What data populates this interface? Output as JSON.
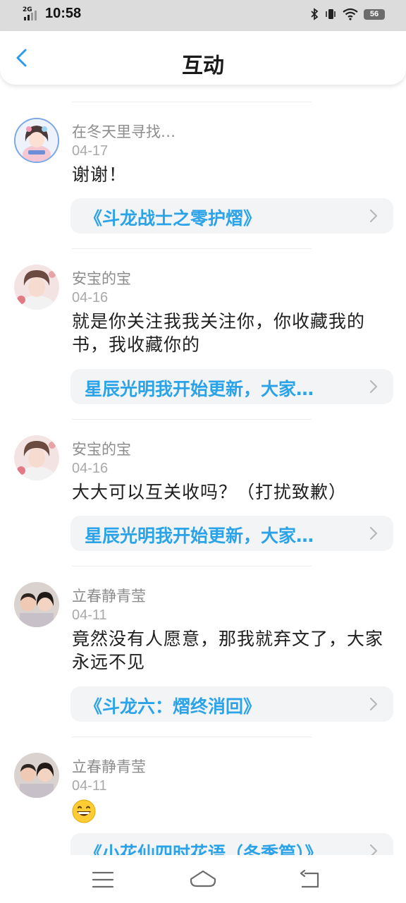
{
  "status_bar": {
    "network": "2G",
    "time": "10:58",
    "battery": "56"
  },
  "header": {
    "title": "互动"
  },
  "posts": [
    {
      "username": "在冬天里寻找…",
      "date": "04-17",
      "message": "谢谢！",
      "link": "《斗龙战士之零护熠》"
    },
    {
      "username": "安宝的宝",
      "date": "04-16",
      "message": "就是你关注我我关注你，你收藏我的书，我收藏你的",
      "link": "星辰光明我开始更新，大家…"
    },
    {
      "username": "安宝的宝",
      "date": "04-16",
      "message": "大大可以互关收吗？（打扰致歉）",
      "link": "星辰光明我开始更新，大家…"
    },
    {
      "username": "立春静青莹",
      "date": "04-11",
      "message": "竟然没有人愿意，那我就弃文了，大家永远不见",
      "link": "《斗龙六：熠终消回》"
    },
    {
      "username": "立春静青莹",
      "date": "04-11",
      "message": "",
      "link": "《小花仙四时花语（冬季篇）》"
    }
  ],
  "icons": {
    "back": "chevron-left-icon",
    "link_arrow": "chevron-right-icon",
    "nav_menu": "menu-icon",
    "nav_home": "home-icon",
    "nav_back": "back-icon"
  },
  "colors": {
    "accent": "#2ba3e8",
    "back_icon": "#2d9be6",
    "status_bar_bg": "#dcdcdc",
    "card_bg": "#f3f4f6"
  }
}
